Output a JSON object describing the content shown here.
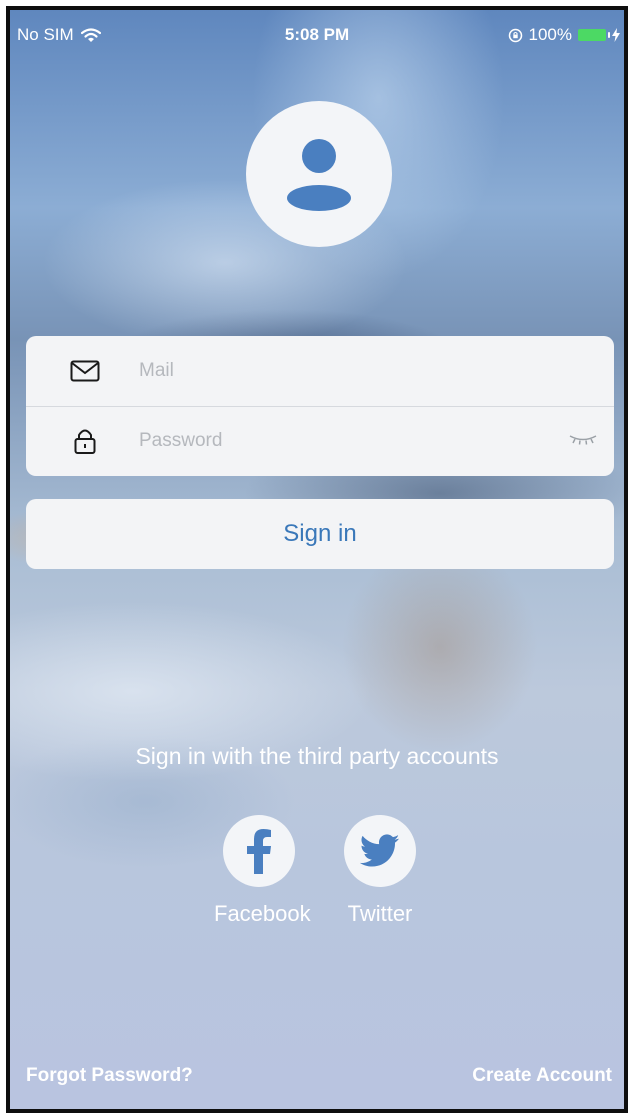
{
  "status_bar": {
    "carrier": "No SIM",
    "time": "5:08 PM",
    "battery": "100%"
  },
  "login": {
    "mail_placeholder": "Mail",
    "password_placeholder": "Password",
    "sign_in_label": "Sign in"
  },
  "third_party": {
    "heading": "Sign in with the third party accounts",
    "providers": [
      {
        "label": "Facebook",
        "icon": "facebook-icon"
      },
      {
        "label": "Twitter",
        "icon": "twitter-icon"
      }
    ]
  },
  "footer": {
    "forgot_password": "Forgot Password?",
    "create_account": "Create Account"
  },
  "colors": {
    "accent": "#3a78b9",
    "battery": "#4cd964",
    "card": "#f3f4f6"
  }
}
